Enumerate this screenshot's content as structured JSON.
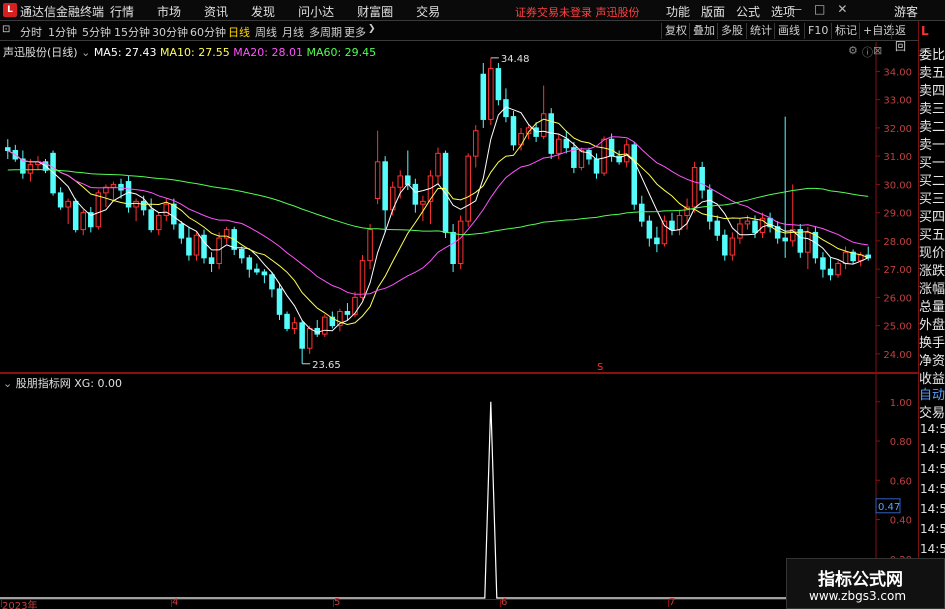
{
  "titlebar": {
    "logo": "L",
    "app_name": "通达信金融终端",
    "menu": [
      "行情",
      "市场",
      "资讯",
      "发现",
      "问小达",
      "财富圈",
      "交易"
    ],
    "warning": "证券交易未登录  声迅股份",
    "right_menu": [
      "功能",
      "版面",
      "公式",
      "选项"
    ],
    "guest": "游客",
    "win_min": "—",
    "win_max": "□",
    "win_close": "✕"
  },
  "toolbar": {
    "timeframes": [
      "分时",
      "1分钟",
      "5分钟",
      "15分钟",
      "30分钟",
      "60分钟",
      "日线",
      "周线",
      "月线",
      "多周期",
      "更多"
    ],
    "active": "日线",
    "buttons": [
      "复权",
      "叠加",
      "多股",
      "统计",
      "画线",
      "F10",
      "标记",
      "+自选",
      "返回"
    ]
  },
  "kline_legend": {
    "stock": "声迅股份(日线)",
    "ma5": "MA5: 27.43",
    "ma10": "MA10: 27.55",
    "ma20": "MA20: 28.01",
    "ma60": "MA60: 29.45"
  },
  "indicator_legend": {
    "name": "股朋指标网",
    "value": "XG: 0.00"
  },
  "colors": {
    "up": "#ff3232",
    "down": "#54fcfc",
    "ma5": "#ffffff",
    "ma10": "#ffff54",
    "ma20": "#ff54ff",
    "ma60": "#54fc54",
    "axis": "#8a1010"
  },
  "right_panel": {
    "top_label": "L",
    "items": [
      "委比",
      "卖五",
      "卖四",
      "卖三",
      "卖二",
      "卖一",
      "买一",
      "买二",
      "买三",
      "买四",
      "买五",
      "现价",
      "涨跌",
      "涨幅",
      "总量",
      "外盘",
      "换手",
      "净资",
      "收益"
    ],
    "items2": [
      "自动",
      "交易"
    ],
    "times": [
      "14:56",
      "14:56",
      "14:56",
      "14:56",
      "14:56",
      "14:56",
      "14:56",
      "14:56",
      "14:56"
    ]
  },
  "chart_data": [
    {
      "type": "candlestick",
      "title": "声迅股份(日线)",
      "y_ticks": [
        34.0,
        33.0,
        32.0,
        31.0,
        30.0,
        29.0,
        28.0,
        27.0,
        26.0,
        25.0,
        24.0
      ],
      "ylim": [
        23.5,
        34.9
      ],
      "x_labels": [
        "2023年",
        "4",
        "5",
        "6",
        "7"
      ],
      "high_label": "34.48",
      "low_label": "23.65",
      "marker": "S",
      "candles": [
        [
          31.3,
          31.6,
          30.9,
          31.2
        ],
        [
          31.2,
          31.4,
          30.8,
          30.9
        ],
        [
          30.9,
          31.2,
          30.2,
          30.4
        ],
        [
          30.4,
          30.9,
          30.1,
          30.7
        ],
        [
          30.7,
          31.0,
          30.5,
          30.8
        ],
        [
          30.8,
          30.9,
          30.4,
          30.5
        ],
        [
          31.1,
          31.2,
          29.6,
          29.7
        ],
        [
          29.7,
          29.9,
          29.1,
          29.2
        ],
        [
          29.2,
          29.5,
          28.6,
          29.4
        ],
        [
          29.4,
          29.5,
          28.3,
          28.4
        ],
        [
          28.4,
          29.1,
          28.2,
          29.0
        ],
        [
          29.0,
          29.2,
          28.3,
          28.5
        ],
        [
          28.5,
          29.8,
          28.4,
          29.7
        ],
        [
          29.7,
          30.0,
          29.2,
          29.9
        ],
        [
          29.9,
          30.1,
          29.4,
          30.0
        ],
        [
          30.0,
          30.2,
          29.5,
          29.8
        ],
        [
          30.1,
          30.3,
          29.0,
          29.2
        ],
        [
          29.2,
          29.5,
          28.7,
          29.4
        ],
        [
          29.4,
          29.6,
          28.9,
          29.1
        ],
        [
          29.1,
          29.5,
          28.3,
          28.4
        ],
        [
          28.4,
          29.0,
          28.2,
          28.9
        ],
        [
          28.9,
          29.5,
          28.7,
          29.3
        ],
        [
          29.3,
          29.5,
          28.4,
          28.6
        ],
        [
          28.6,
          28.7,
          27.9,
          28.1
        ],
        [
          28.1,
          28.5,
          27.3,
          27.5
        ],
        [
          27.5,
          28.3,
          27.3,
          28.2
        ],
        [
          28.2,
          28.4,
          27.2,
          27.4
        ],
        [
          27.4,
          27.6,
          26.9,
          27.2
        ],
        [
          27.2,
          28.3,
          27.0,
          28.1
        ],
        [
          28.1,
          28.5,
          27.9,
          28.4
        ],
        [
          28.4,
          28.5,
          27.5,
          27.7
        ],
        [
          27.7,
          27.8,
          27.2,
          27.4
        ],
        [
          27.4,
          27.5,
          26.7,
          27.0
        ],
        [
          27.0,
          27.2,
          26.8,
          26.9
        ],
        [
          26.9,
          27.0,
          26.5,
          26.8
        ],
        [
          26.8,
          26.9,
          26.0,
          26.3
        ],
        [
          26.3,
          26.5,
          25.2,
          25.4
        ],
        [
          25.4,
          25.5,
          24.8,
          24.9
        ],
        [
          24.9,
          25.3,
          24.7,
          25.1
        ],
        [
          25.1,
          25.2,
          23.65,
          24.2
        ],
        [
          24.2,
          25.0,
          24.0,
          24.9
        ],
        [
          24.9,
          25.2,
          24.6,
          24.7
        ],
        [
          24.7,
          25.4,
          24.6,
          25.3
        ],
        [
          25.3,
          25.5,
          24.9,
          25.0
        ],
        [
          25.0,
          25.6,
          24.8,
          25.5
        ],
        [
          25.5,
          25.8,
          25.2,
          25.4
        ],
        [
          25.4,
          26.2,
          25.3,
          26.0
        ],
        [
          26.0,
          27.5,
          25.9,
          27.3
        ],
        [
          27.3,
          28.6,
          27.0,
          28.4
        ],
        [
          29.5,
          31.9,
          29.3,
          30.8
        ],
        [
          30.8,
          31.0,
          28.3,
          29.1
        ],
        [
          29.1,
          30.1,
          28.9,
          29.9
        ],
        [
          29.9,
          30.5,
          29.5,
          30.3
        ],
        [
          30.3,
          31.2,
          29.8,
          30.0
        ],
        [
          30.0,
          30.2,
          29.0,
          29.3
        ],
        [
          29.3,
          29.6,
          28.7,
          29.4
        ],
        [
          29.4,
          30.5,
          28.6,
          30.3
        ],
        [
          30.3,
          31.3,
          30.0,
          31.1
        ],
        [
          31.1,
          31.2,
          28.1,
          28.3
        ],
        [
          28.3,
          28.6,
          26.9,
          27.2
        ],
        [
          27.2,
          28.9,
          27.0,
          28.7
        ],
        [
          28.7,
          31.1,
          28.5,
          31.0
        ],
        [
          31.0,
          32.1,
          30.6,
          31.9
        ],
        [
          33.9,
          34.3,
          32.0,
          32.3
        ],
        [
          32.3,
          34.48,
          32.1,
          34.1
        ],
        [
          34.1,
          34.3,
          32.8,
          33.0
        ],
        [
          33.0,
          33.4,
          32.2,
          32.4
        ],
        [
          32.4,
          32.6,
          31.2,
          31.4
        ],
        [
          31.4,
          32.0,
          31.2,
          31.8
        ],
        [
          31.8,
          32.1,
          31.6,
          32.0
        ],
        [
          32.0,
          32.2,
          31.5,
          31.7
        ],
        [
          31.7,
          33.5,
          31.6,
          32.5
        ],
        [
          32.5,
          32.7,
          30.9,
          31.1
        ],
        [
          31.1,
          31.8,
          30.9,
          31.6
        ],
        [
          31.6,
          31.9,
          31.1,
          31.3
        ],
        [
          31.3,
          31.5,
          30.4,
          30.6
        ],
        [
          30.6,
          31.3,
          30.5,
          31.2
        ],
        [
          31.2,
          31.3,
          30.7,
          30.9
        ],
        [
          30.9,
          31.1,
          30.2,
          30.4
        ],
        [
          30.4,
          31.7,
          30.3,
          31.6
        ],
        [
          31.6,
          31.8,
          30.8,
          31.0
        ],
        [
          31.0,
          31.2,
          30.7,
          30.8
        ],
        [
          30.8,
          31.6,
          30.6,
          31.4
        ],
        [
          31.4,
          31.5,
          29.1,
          29.3
        ],
        [
          29.3,
          29.6,
          28.5,
          28.7
        ],
        [
          28.7,
          28.9,
          27.8,
          28.1
        ],
        [
          28.1,
          28.5,
          27.6,
          27.9
        ],
        [
          27.9,
          28.9,
          27.8,
          28.7
        ],
        [
          28.7,
          29.0,
          28.2,
          28.4
        ],
        [
          28.4,
          29.1,
          28.2,
          28.9
        ],
        [
          28.9,
          29.5,
          28.4,
          29.2
        ],
        [
          29.2,
          30.8,
          29.0,
          30.6
        ],
        [
          30.6,
          30.8,
          29.5,
          29.8
        ],
        [
          29.8,
          30.0,
          28.4,
          28.7
        ],
        [
          28.7,
          28.9,
          28.0,
          28.2
        ],
        [
          28.2,
          28.4,
          27.3,
          27.5
        ],
        [
          27.5,
          28.3,
          27.3,
          28.1
        ],
        [
          28.1,
          28.8,
          27.9,
          28.6
        ],
        [
          28.6,
          28.9,
          28.4,
          28.7
        ],
        [
          28.7,
          28.9,
          28.1,
          28.3
        ],
        [
          28.3,
          29.0,
          28.1,
          28.8
        ],
        [
          28.8,
          29.0,
          28.3,
          28.5
        ],
        [
          28.5,
          28.7,
          27.9,
          28.1
        ],
        [
          28.1,
          32.4,
          27.4,
          28.0
        ],
        [
          28.0,
          30.0,
          27.8,
          28.4
        ],
        [
          28.4,
          28.6,
          27.4,
          27.6
        ],
        [
          27.6,
          28.5,
          27.0,
          28.3
        ],
        [
          28.3,
          28.5,
          27.2,
          27.4
        ],
        [
          27.4,
          27.6,
          26.7,
          27.0
        ],
        [
          27.0,
          27.4,
          26.6,
          26.8
        ],
        [
          26.8,
          27.3,
          26.7,
          27.2
        ],
        [
          27.2,
          27.8,
          27.0,
          27.6
        ],
        [
          27.6,
          27.7,
          27.2,
          27.3
        ],
        [
          27.3,
          27.6,
          27.1,
          27.5
        ],
        [
          27.5,
          27.8,
          27.3,
          27.4
        ]
      ]
    },
    {
      "type": "line",
      "title": "股朋指标网",
      "y_ticks": [
        1.0,
        0.8,
        0.6,
        0.4,
        0.2
      ],
      "ylim": [
        0,
        1.05
      ],
      "current_value_label": "0.47",
      "series": [
        {
          "values_spike_index": 64,
          "spike_value": 1.0
        }
      ]
    }
  ]
}
